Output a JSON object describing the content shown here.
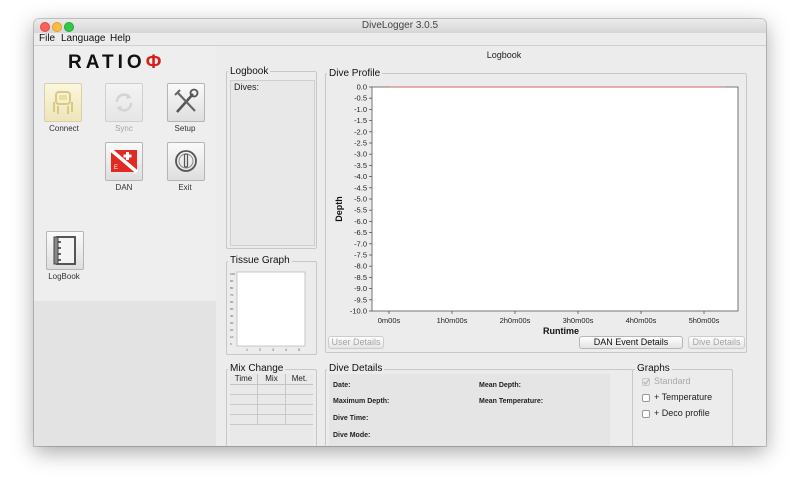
{
  "window": {
    "title": "DiveLogger 3.0.5"
  },
  "menu": {
    "items": [
      "File",
      "Language",
      "Help"
    ]
  },
  "logo": {
    "text": "RATIO",
    "symbol": "Φ",
    "symbol_color": "#d2221b"
  },
  "toolbar": {
    "connect": {
      "label": "Connect",
      "icon": "dive-computer-icon"
    },
    "sync": {
      "label": "Sync",
      "icon": "sync-icon"
    },
    "setup": {
      "label": "Setup",
      "icon": "tools-icon"
    },
    "dan": {
      "label": "DAN",
      "icon": "dive-flag-icon"
    },
    "exit": {
      "label": "Exit",
      "icon": "power-icon"
    },
    "logbook": {
      "label": "LogBook",
      "icon": "binder-icon"
    }
  },
  "center": {
    "title": "Logbook"
  },
  "logbook_panel": {
    "title": "Logbook",
    "dives_label": "Dives:"
  },
  "tissue_graph": {
    "title": "Tissue Graph",
    "yticks": [
      "100",
      "90",
      "80",
      "70",
      "60",
      "50",
      "40",
      "30",
      "20",
      "10",
      "0"
    ],
    "xticks": [
      "1",
      "2",
      "3",
      "4",
      "5"
    ]
  },
  "mix_change": {
    "title": "Mix Change",
    "headers": [
      "Time",
      "Mix",
      "Met."
    ],
    "rows": 4
  },
  "dive_profile": {
    "title": "Dive Profile",
    "buttons": {
      "user_details": "User Details",
      "dan_event_details": "DAN Event Details",
      "dive_details": "Dive Details"
    }
  },
  "chart_data": {
    "type": "line",
    "xlabel": "Runtime",
    "ylabel": "Depth",
    "x_ticks": [
      "0m00s",
      "1h0m00s",
      "2h0m00s",
      "3h0m00s",
      "4h0m00s",
      "5h0m00s"
    ],
    "y_ticks": [
      "0.0",
      "-0.5",
      "-1.0",
      "-1.5",
      "-2.0",
      "-2.5",
      "-3.0",
      "-3.5",
      "-4.0",
      "-4.5",
      "-5.0",
      "-5.5",
      "-6.0",
      "-6.5",
      "-7.0",
      "-7.5",
      "-8.0",
      "-8.5",
      "-9.0",
      "-9.5",
      "-10.0"
    ],
    "ylim": [
      -10.0,
      0.0
    ],
    "series": [
      {
        "x_seconds": [
          0,
          19200
        ],
        "y": [
          0.0,
          0.0
        ],
        "color": "#c9676b"
      }
    ]
  },
  "dive_details": {
    "title": "Dive Details",
    "fields": {
      "date": "Date:",
      "mean_depth": "Mean Depth:",
      "max_depth": "Maximum Depth:",
      "mean_temp": "Mean Temperature:",
      "dive_time": "Dive Time:",
      "dive_mode": "Dive Mode:"
    }
  },
  "graphs": {
    "title": "Graphs",
    "standard": {
      "label": "Standard",
      "checked": true
    },
    "temperature": {
      "label": "+ Temperature",
      "checked": false
    },
    "deco": {
      "label": "+ Deco profile",
      "checked": false
    }
  }
}
